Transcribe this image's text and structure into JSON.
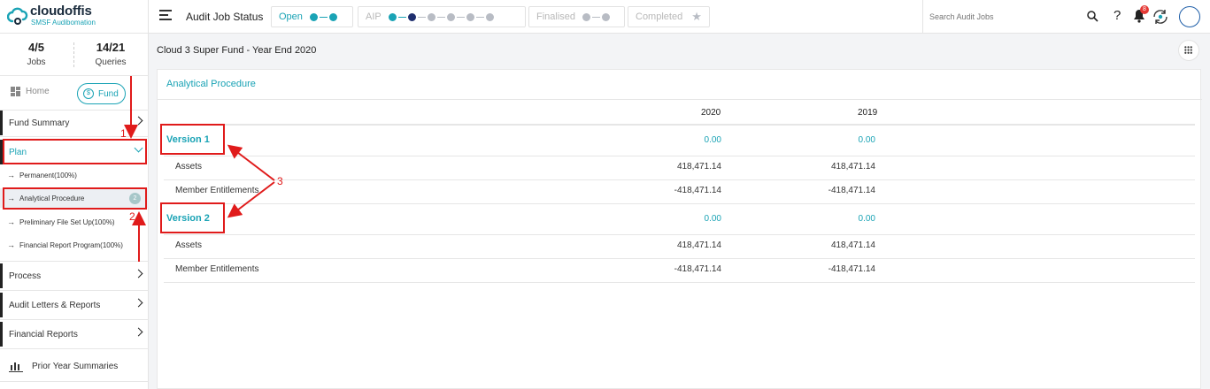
{
  "brand": {
    "name": "cloudoffis",
    "tagline": "SMSF Audibomation"
  },
  "status_bar": {
    "title": "Audit Job Status",
    "stages": [
      {
        "label": "Open",
        "state": "active"
      },
      {
        "label": "AIP",
        "state": "pending"
      },
      {
        "label": "Finalised",
        "state": "pending"
      },
      {
        "label": "Completed",
        "state": "pending"
      }
    ]
  },
  "search": {
    "placeholder": "Search Audit Jobs"
  },
  "header_icons": {
    "help": "?",
    "notification_count": "8"
  },
  "stats": [
    {
      "value": "4/5",
      "label": "Jobs"
    },
    {
      "value": "14/21",
      "label": "Queries"
    }
  ],
  "view_toggle": {
    "home": "Home",
    "fund": "Fund",
    "fund_icon": "$"
  },
  "sidebar": {
    "items": [
      {
        "label": "Fund Summary"
      },
      {
        "label": "Plan"
      },
      {
        "label": "Process"
      },
      {
        "label": "Audit Letters & Reports"
      },
      {
        "label": "Financial Reports"
      }
    ],
    "plan_subitems": [
      {
        "label": "Permanent(100%)"
      },
      {
        "label": "Analytical Procedure",
        "badge": "2"
      },
      {
        "label": "Preliminary File Set Up(100%)"
      },
      {
        "label": "Financial Report Program(100%)"
      }
    ],
    "prior": "Prior Year Summaries",
    "arrow_glyph": "→"
  },
  "page": {
    "title": "Cloud 3 Super Fund - Year End 2020"
  },
  "card": {
    "title": "Analytical Procedure",
    "columns": [
      "2020",
      "2019"
    ],
    "versions": [
      {
        "name": "Version 1",
        "totals": [
          "0.00",
          "0.00"
        ],
        "rows": [
          {
            "label": "Assets",
            "values": [
              "418,471.14",
              "418,471.14"
            ]
          },
          {
            "label": "Member Entitlements",
            "values": [
              "-418,471.14",
              "-418,471.14"
            ]
          }
        ]
      },
      {
        "name": "Version 2",
        "totals": [
          "0.00",
          "0.00"
        ],
        "rows": [
          {
            "label": "Assets",
            "values": [
              "418,471.14",
              "418,471.14"
            ]
          },
          {
            "label": "Member Entitlements",
            "values": [
              "-418,471.14",
              "-418,471.14"
            ]
          }
        ]
      }
    ]
  },
  "annotations": {
    "one": "1",
    "two": "2",
    "three": "3"
  },
  "colors": {
    "accent": "#1aa3b5",
    "annotation": "#e01b1b",
    "navy": "#1e2e6e"
  }
}
